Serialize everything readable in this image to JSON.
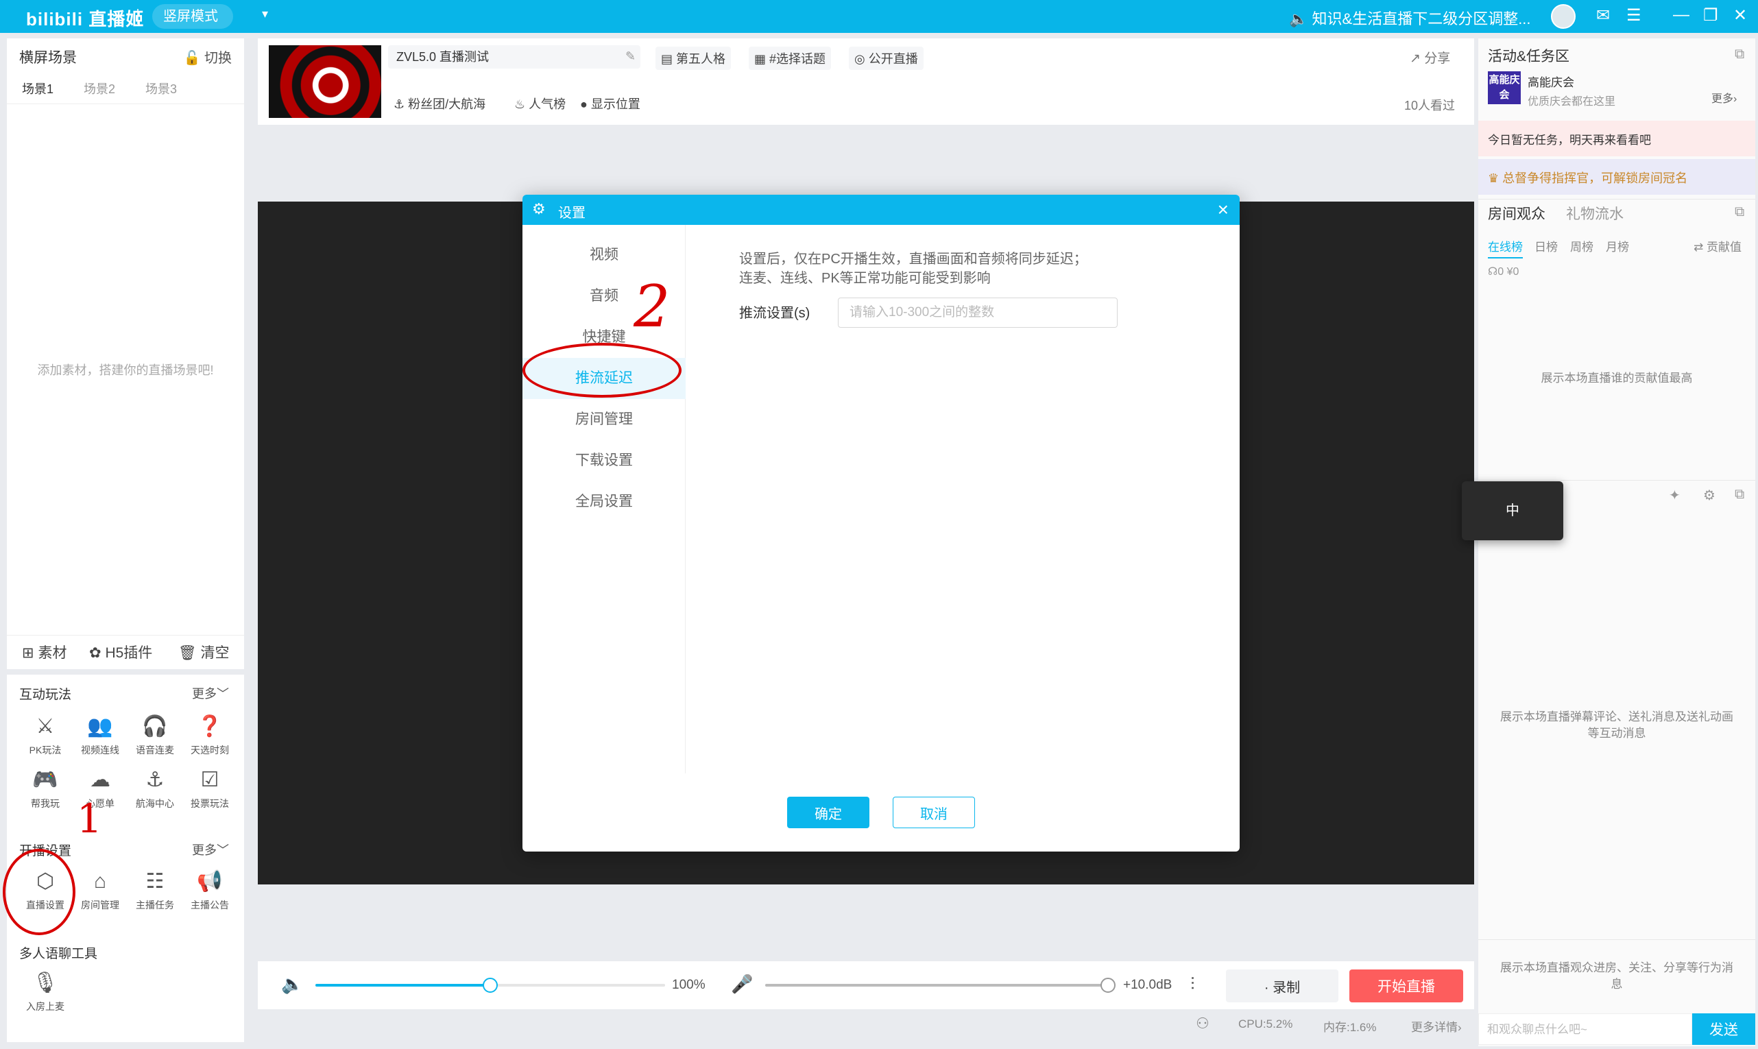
{
  "titlebar": {
    "logo": "bilibili 直播姬",
    "mode": "竖屏模式",
    "notice": "知识&生活直播下二级分区调整...",
    "icons": [
      "avatar",
      "mail-icon",
      "menu-icon",
      "minimize-icon",
      "maximize-icon",
      "close-icon"
    ]
  },
  "left": {
    "title": "横屏场景",
    "switch_label": "切换",
    "scenes": [
      "场景1",
      "场景2",
      "场景3"
    ],
    "empty_hint": "添加素材，搭建你的直播场景吧!",
    "actions": [
      "素材",
      "H5插件",
      "清空"
    ],
    "interactive": {
      "title": "互动玩法",
      "more": "更多",
      "tools": [
        "PK玩法",
        "视频连线",
        "语音连麦",
        "天选时刻",
        "帮我玩",
        "心愿单",
        "航海中心",
        "投票玩法"
      ]
    },
    "broadcast": {
      "title": "开播设置",
      "more": "更多",
      "tools": [
        "直播设置",
        "房间管理",
        "主播任务",
        "主播公告"
      ]
    },
    "voice": {
      "title": "多人语聊工具",
      "tools": [
        "入房上麦"
      ]
    }
  },
  "header": {
    "room_title": "ZVL5.0 直播测试",
    "category": "第五人格",
    "topic": "#选择话题",
    "visibility": "公开直播",
    "fan_group": "粉丝团/大航海",
    "popularity": "人气榜",
    "location": "显示位置",
    "share": "分享",
    "viewers": "10人看过"
  },
  "dialog": {
    "title": "设置",
    "nav": [
      "视频",
      "音频",
      "快捷键",
      "推流延迟",
      "房间管理",
      "下载设置",
      "全局设置"
    ],
    "active_index": 3,
    "desc_line1": "设置后，仅在PC开播生效，直播画面和音频将同步延迟；",
    "desc_line2": "连麦、连线、PK等正常功能可能受到影响",
    "field_label": "推流设置(s)",
    "field_placeholder": "请输入10-300之间的整数",
    "field_value": "",
    "ok": "确定",
    "cancel": "取消"
  },
  "annotations": {
    "mark1": "1",
    "mark2": "2",
    "color": "#d80000"
  },
  "bottom": {
    "speaker_level": 0.5,
    "volume_label": "100%",
    "mic_level": 1.0,
    "mic_label": "+10.0dB",
    "record": "录制",
    "start_live": "开始直播"
  },
  "status": {
    "cpu": "CPU:5.2%",
    "mem": "内存:1.6%",
    "more": "更多详情"
  },
  "right": {
    "activity_title": "活动&任务区",
    "badge": "高能庆会",
    "activity_name": "高能庆会",
    "activity_sub": "优质庆会都在这里",
    "activity_more": "更多",
    "task_banner": "今日暂无任务，明天再来看看吧",
    "crown_banner": "总督争得指挥官，可解锁房间冠名",
    "tabs": [
      "房间观众",
      "礼物流水"
    ],
    "rank_tabs": [
      "在线榜",
      "日榜",
      "周榜",
      "月榜"
    ],
    "contribution": "贡献值",
    "counts": "0  ¥0",
    "rank_hint": "展示本场直播谁的贡献值最高",
    "danmaku_hint": "展示本场直播弹幕评论、送礼消息及送礼动画等互动消息",
    "enter_hint": "展示本场直播观众进房、关注、分享等行为消息",
    "chat_placeholder": "和观众聊点什么吧~",
    "send": "发送"
  },
  "ime": "中",
  "colors": {
    "accent": "#0bb6ec",
    "live": "#fd5d5d",
    "annotation": "#d80000"
  }
}
